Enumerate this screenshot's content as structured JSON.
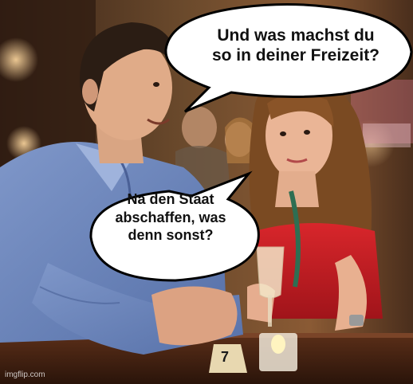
{
  "speech_bubbles": {
    "top": "Und was machst du\nso in deiner Freizeit?",
    "bottom": "Na den Staat\nabschaffen, was\ndenn sonst?"
  },
  "table_number": "7",
  "watermark": "imgflip.com"
}
